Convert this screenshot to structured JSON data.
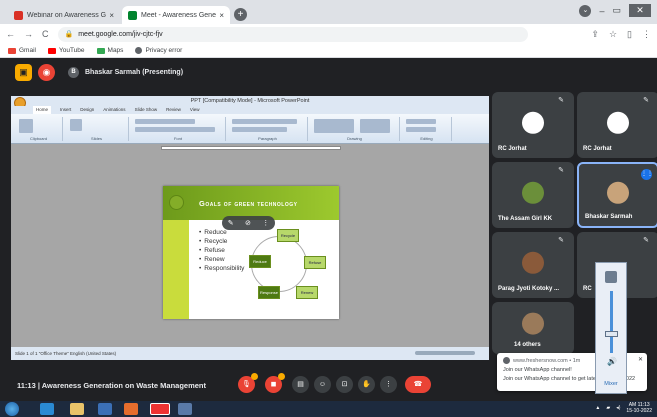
{
  "browser": {
    "tabs": [
      {
        "title": "Webinar on Awareness Generati",
        "color": "#d93025"
      },
      {
        "title": "Meet - Awareness Generatio",
        "color": "#00832d"
      }
    ],
    "new_tab": "+",
    "window_buttons": {
      "minimize": "‒",
      "maximize": "▭",
      "close": "✕"
    },
    "url": "meet.google.com/jiv-cjtc-fjv",
    "bookmarks": [
      {
        "label": "Gmail",
        "color": "#ea4335"
      },
      {
        "label": "YouTube",
        "color": "#ff0000"
      },
      {
        "label": "Maps",
        "color": "#34a853"
      },
      {
        "label": "Privacy error",
        "color": "#5f6368"
      }
    ]
  },
  "meet_top": {
    "presenter_label": "Bhaskar Sarmah (Presenting)"
  },
  "ppt": {
    "window_title": "PPT [Compatibility Mode] - Microsoft PowerPoint",
    "tabs": [
      "Home",
      "Insert",
      "Design",
      "Animations",
      "Slide Show",
      "Review",
      "View"
    ],
    "ribbon_groups": [
      "Clipboard",
      "Slides",
      "Font",
      "Paragraph",
      "Drawing",
      "Editing"
    ],
    "status_text": "Slide 1 of 1    \"Office Theme\"    English (United States)"
  },
  "slide": {
    "title": "Goals of green technology",
    "bullets": [
      "Reduce",
      "Recycle",
      "Refuse",
      "Renew",
      "Responsibility"
    ],
    "cycle_nodes": {
      "recycle": "Recycle",
      "refuse": "Refuse",
      "renew": "Renew",
      "response": "Response",
      "reduce": "Reduce"
    }
  },
  "participants": [
    {
      "name": "RC Jorhat",
      "avatar_color": "#ffffff"
    },
    {
      "name": "RC Jorhat",
      "avatar_color": "#ffffff"
    },
    {
      "name": "The Assam Girl KK",
      "avatar_color": "#6b8f3a"
    },
    {
      "name": "Bhaskar Sarmah",
      "avatar_color": "#c8a37a"
    },
    {
      "name": "Parag Jyoti Kotoky ...",
      "avatar_color": "#8a5a3a"
    },
    {
      "name": "RC",
      "avatar_color": "#5f6368"
    },
    {
      "name": "14 others",
      "avatar_color": "#9a7a5a"
    }
  ],
  "meeting": {
    "time": "11:13",
    "title": "Awareness Generation on Waste Management"
  },
  "notification": {
    "source": "www.freshersnow.com • 1m",
    "line1": "Join our WhatsApp channel!",
    "line2": "Join our WhatsApp channel to get latest updates 2022"
  },
  "mixer": {
    "label": "Mixer",
    "level": 0.3
  },
  "taskbar": {
    "time": "AM 11:13",
    "date": "15-10-2022"
  }
}
